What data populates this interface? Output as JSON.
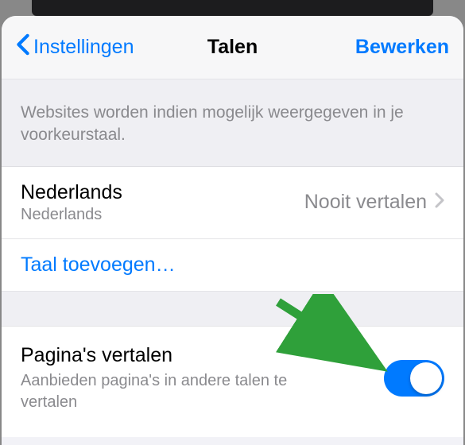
{
  "nav": {
    "back_label": "Instellingen",
    "title": "Talen",
    "right_label": "Bewerken"
  },
  "section_description": "Websites worden indien mogelijk weergegeven in je voorkeurstaal.",
  "language_row": {
    "title": "Nederlands",
    "subtitle": "Nederlands",
    "detail": "Nooit vertalen"
  },
  "add_language_label": "Taal toevoegen…",
  "translate": {
    "title": "Pagina's vertalen",
    "subtitle": "Aanbieden pagina's in andere talen te vertalen",
    "enabled": true
  },
  "colors": {
    "accent": "#007aff",
    "arrow": "#2fa03a"
  }
}
